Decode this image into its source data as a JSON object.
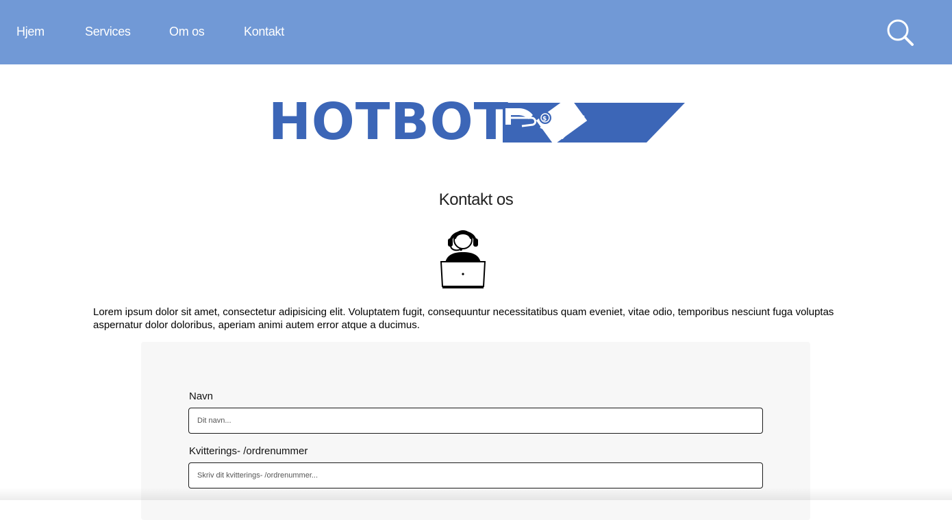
{
  "nav": {
    "items": [
      {
        "label": "Hjem"
      },
      {
        "label": "Services"
      },
      {
        "label": "Om os"
      },
      {
        "label": "Kontakt"
      }
    ],
    "search_icon": "search-icon"
  },
  "logo": {
    "text": "HOTBOT",
    "mark_icon": "hand-with-money-icon"
  },
  "page": {
    "title": "Kontakt os",
    "illustration_icon": "support-agent-icon",
    "intro": "Lorem ipsum dolor sit amet, consectetur adipisicing elit. Voluptatem fugit, consequuntur necessitatibus quam eveniet, vitae odio, temporibus nesciunt fuga voluptas aspernatur dolor doloribus, aperiam animi autem error atque a ducimus."
  },
  "form": {
    "name_label": "Navn",
    "name_placeholder": "Dit navn...",
    "order_label": "Kvitterings- /ordrenummer",
    "order_placeholder": "Skriv dit kvitterings- /ordrenummer..."
  },
  "colors": {
    "nav_bg": "#7199d6",
    "brand_blue": "#3c66b7",
    "form_bg": "#f7f7f7"
  }
}
